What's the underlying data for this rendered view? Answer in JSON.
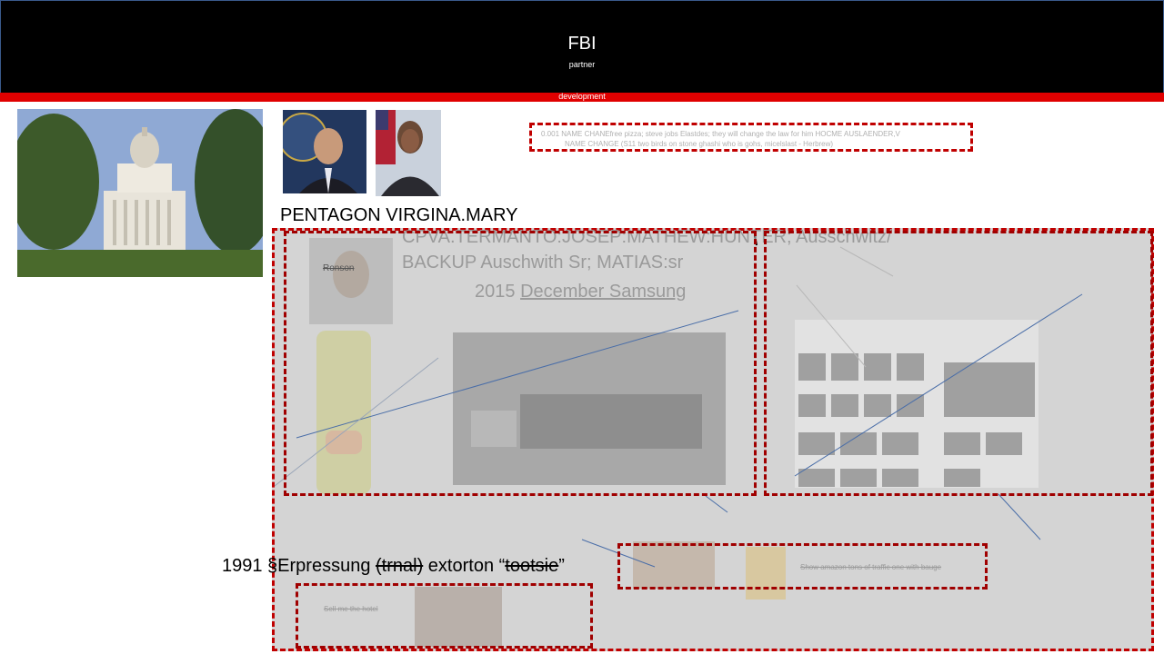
{
  "header": {
    "title": "FBI",
    "subtitle": "partner"
  },
  "bar": {
    "label": "development"
  },
  "note_box": {
    "line1": "0.001 NAME CHANEfree pizza; steve jobs Elastdes; they will change the law for him HOCME AUSLAENDER,V",
    "line2": "NAME CHANGE (S11 two birds on stone ghashi who is gohs, micelslast - Herbrew)"
  },
  "heading": "PENTAGON VIRGINA.MARY",
  "slide": {
    "label_ronson": "Ronson",
    "line1": "CPVA.TERMANTO:JOSEP:MATHEW:HUNTER; Ausschwitz/",
    "line2": "BACKUP Auschwith Sr; MATIAS:sr",
    "line3_year": "2015",
    "line3_rest": "December Samsung",
    "note_right": "Show amazon tons of traffic one with bauge",
    "note_bottom": "Sell me the hotel"
  },
  "bottom_line": {
    "prefix": "1991 §Erpressung ",
    "strike1": "(trnal)",
    "middle": " extorton “",
    "strike2": "tootsie",
    "suffix": "”"
  },
  "icons": {
    "capitol": "capitol-building-photo",
    "portrait1": "official-portrait-photo",
    "portrait2": "official-portrait-photo"
  }
}
